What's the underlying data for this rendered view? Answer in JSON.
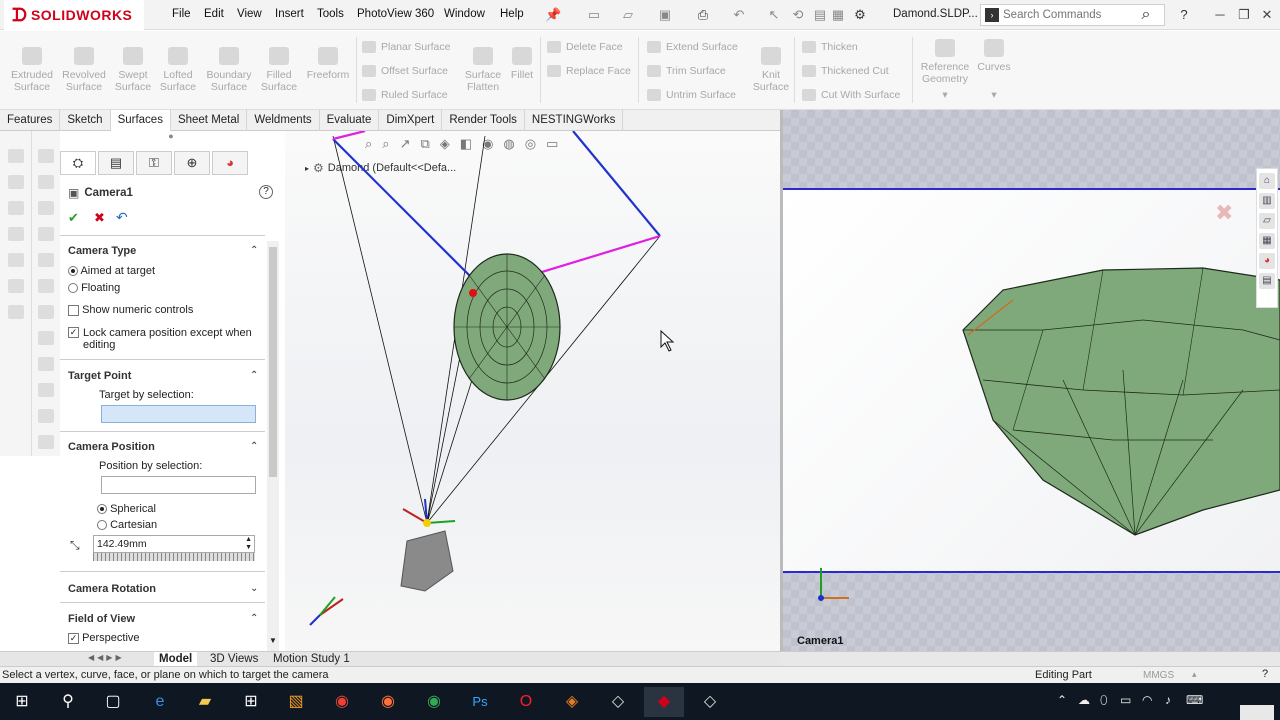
{
  "app": {
    "brand": "SOLIDWORKS"
  },
  "menu": [
    "File",
    "Edit",
    "View",
    "Insert",
    "Tools",
    "PhotoView 360",
    "Window",
    "Help"
  ],
  "document_title": "Damond.SLDP...",
  "search": {
    "placeholder": "Search Commands"
  },
  "ribbon": {
    "big_buttons": [
      "Extruded Surface",
      "Revolved Surface",
      "Swept Surface",
      "Lofted Surface",
      "Boundary Surface",
      "Filled Surface",
      "Freeform"
    ],
    "col1": [
      "Planar Surface",
      "Offset Surface",
      "Ruled Surface"
    ],
    "col1_extra": [
      {
        "label": "Surface Flatten"
      },
      {
        "label": "Fillet"
      }
    ],
    "col2": [
      "Delete Face",
      "Replace Face"
    ],
    "col3": [
      "Extend Surface",
      "Trim Surface",
      "Untrim Surface"
    ],
    "knit": "Knit Surface",
    "col4": [
      "Thicken",
      "Thickened Cut",
      "Cut With Surface"
    ],
    "ref_geometry": "Reference Geometry",
    "curves": "Curves"
  },
  "tabs": [
    "Features",
    "Sketch",
    "Surfaces",
    "Sheet Metal",
    "Weldments",
    "Evaluate",
    "DimXpert",
    "Render Tools",
    "NESTINGWorks"
  ],
  "active_tab": "Surfaces",
  "property_manager": {
    "title": "Camera1",
    "camera_type": {
      "title": "Camera Type",
      "options": [
        "Aimed at target",
        "Floating"
      ],
      "selected": "Aimed at target"
    },
    "show_numeric": "Show numeric controls",
    "lock_camera": "Lock camera position except when editing",
    "target_point": {
      "title": "Target Point",
      "label": "Target by selection:",
      "value": ""
    },
    "camera_position": {
      "title": "Camera Position",
      "label": "Position by selection:",
      "value": "",
      "options": [
        "Spherical",
        "Cartesian"
      ],
      "selected": "Spherical",
      "distance": "142.49mm"
    },
    "camera_rotation": {
      "title": "Camera Rotation"
    },
    "field_of_view": {
      "title": "Field of View",
      "perspective": "Perspective"
    }
  },
  "tree": {
    "root": "Damond  (Default<<Defa..."
  },
  "right_view": {
    "label": "Camera1"
  },
  "bottom_tabs": [
    "Model",
    "3D Views",
    "Motion Study 1"
  ],
  "active_bottom_tab": "Model",
  "status": {
    "message": "Select a vertex, curve, face, or plane on which to target the camera",
    "mode": "Editing Part",
    "units": "MMGS"
  },
  "taskbar": [
    "start-icon",
    "search-icon",
    "task-view-icon",
    "edge-icon",
    "file-explorer-icon",
    "store-icon",
    "sublime-icon",
    "chrome-icon",
    "firefox-icon",
    "chrome-dev-icon",
    "photoshop-icon",
    "opera-icon",
    "app-icon",
    "app2-icon",
    "solidworks-icon",
    "edrawings-icon"
  ],
  "colors": {
    "accent_red": "#d0021b",
    "camera_frame": "#2a2ad0",
    "frustum": "#e020e0",
    "gem": "#7fa97a"
  }
}
